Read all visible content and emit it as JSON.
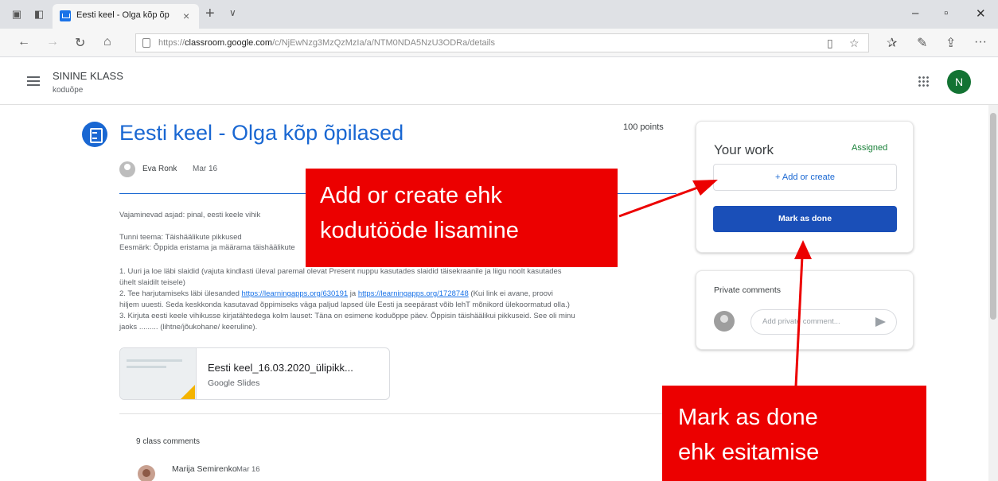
{
  "browser": {
    "tab_title": "Eesti keel - Olga kõp õp",
    "tab_close": "×",
    "new_tab": "+",
    "tab_menu": "∨",
    "url_domain": "classroom.google.com",
    "url_prefix": "https://",
    "url_path": "/c/NjEwNzg3MzQzMzIa/a/NTM0NDA5NzU3ODRa/details",
    "icons": [
      "tab-actions-icon",
      "back-tab-icon",
      "back-icon",
      "forward-icon",
      "refresh-icon",
      "home-icon",
      "lock-icon",
      "reading-view-icon",
      "favorite-star-icon",
      "favorites-icon",
      "pen-icon",
      "share-icon",
      "more-icon",
      "minimize-icon",
      "maximize-icon",
      "close-icon"
    ]
  },
  "header": {
    "class_name": "SININE KLASS",
    "class_subtitle": "koduõpe",
    "avatar_letter": "N"
  },
  "assignment": {
    "title": "Eesti keel - Olga kõp õpilased",
    "points": "100 points",
    "author": "Eva Ronk",
    "date": "Mar 16",
    "description": {
      "line1": "Vajaminevad asjad: pinal, eesti keele vihik",
      "line2": "Tunni teema: Täishäälikute pikkused",
      "line3": "Eesmärk: Õppida eristama ja määrama täishäälikute",
      "line4": "1. Uuri ja loe läbi slaidid (vajuta kindlasti üleval paremal olevat Present nuppu kasutades slaidid täisekraanile ja liigu noolt kasutades",
      "line5": "ühelt slaidilt teisele)",
      "line6_start": "2. Tee harjutamiseks läbi ülesanded ",
      "link1": "https://learningapps.org/630191",
      "line6_mid": " ja ",
      "link2": "https://learningapps.org/1728748",
      "line6_end": " (Kui link ei avane, proovi",
      "line7": "hiljem uuesti. Seda keskkonda kasutavad õppimiseks väga paljud lapsed üle Eesti ja seepärast võib lehT mõnikord ülekoormatud olla.)",
      "line8": "3. Kirjuta eesti keele vihikusse kirjatähtedega kolm lauset: Täna on esimene koduõppe päev. Õppisin täishäälikui pikkuseid. See oli minu",
      "line9": "jaoks ......... (lihtne/jõukohane/ keeruline)."
    },
    "attachment": {
      "title": "Eesti keel_16.03.2020_ülipikk...",
      "type": "Google Slides"
    },
    "comments": {
      "count_label": "9 class comments",
      "first_author": "Marija Semirenko",
      "first_date": "Mar 16"
    }
  },
  "your_work": {
    "title": "Your work",
    "status": "Assigned",
    "add_label": "+  Add or create",
    "mark_done_label": "Mark as done"
  },
  "private_comments": {
    "title": "Private comments",
    "placeholder": "Add private comment..."
  },
  "annotations": {
    "callout1_line1": "Add or create ehk",
    "callout1_line2": "kodutööde lisamine",
    "callout2_line1": "Mark as done",
    "callout2_line2": "ehk esitamise",
    "color": "#ec0000"
  },
  "colors": {
    "accent": "#1967d2",
    "button": "#1a4fb8",
    "assigned": "#188038",
    "avatar": "#137333"
  }
}
